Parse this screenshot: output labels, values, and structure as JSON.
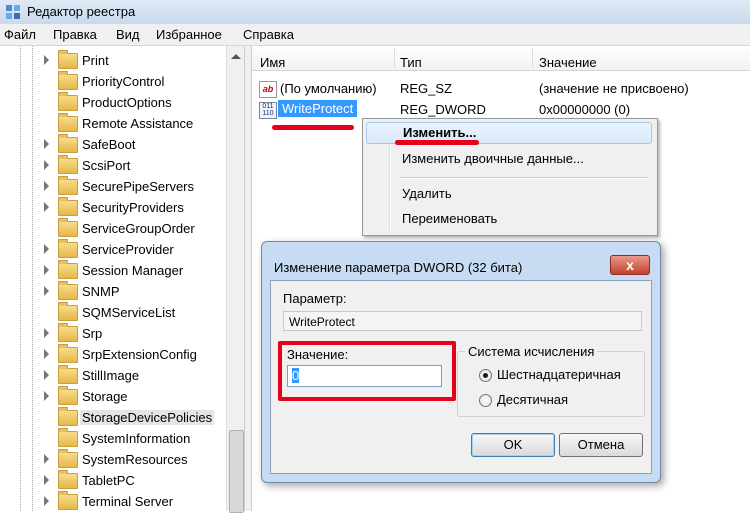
{
  "window": {
    "title": "Редактор реестра"
  },
  "menu": [
    "Файл",
    "Правка",
    "Вид",
    "Избранное",
    "Справка"
  ],
  "tree": {
    "items": [
      {
        "label": "Print",
        "expandable": true
      },
      {
        "label": "PriorityControl",
        "expandable": false
      },
      {
        "label": "ProductOptions",
        "expandable": false
      },
      {
        "label": "Remote Assistance",
        "expandable": false
      },
      {
        "label": "SafeBoot",
        "expandable": true
      },
      {
        "label": "ScsiPort",
        "expandable": true
      },
      {
        "label": "SecurePipeServers",
        "expandable": true
      },
      {
        "label": "SecurityProviders",
        "expandable": true
      },
      {
        "label": "ServiceGroupOrder",
        "expandable": false
      },
      {
        "label": "ServiceProvider",
        "expandable": true
      },
      {
        "label": "Session Manager",
        "expandable": true
      },
      {
        "label": "SNMP",
        "expandable": true
      },
      {
        "label": "SQMServiceList",
        "expandable": false
      },
      {
        "label": "Srp",
        "expandable": true
      },
      {
        "label": "SrpExtensionConfig",
        "expandable": true
      },
      {
        "label": "StillImage",
        "expandable": true
      },
      {
        "label": "Storage",
        "expandable": true
      },
      {
        "label": "StorageDevicePolicies",
        "expandable": false,
        "selected": true
      },
      {
        "label": "SystemInformation",
        "expandable": false
      },
      {
        "label": "SystemResources",
        "expandable": true
      },
      {
        "label": "TabletPC",
        "expandable": true
      },
      {
        "label": "Terminal Server",
        "expandable": true
      }
    ]
  },
  "list": {
    "headers": {
      "name": "Имя",
      "type": "Тип",
      "value": "Значение"
    },
    "rows": [
      {
        "name": "(По умолчанию)",
        "type": "REG_SZ",
        "value": "(значение не присвоено)",
        "icon": "string-value-icon"
      },
      {
        "name": "WriteProtect",
        "type": "REG_DWORD",
        "value": "0x00000000 (0)",
        "icon": "binary-value-icon"
      }
    ]
  },
  "context_menu": {
    "modify": "Изменить...",
    "modify_binary": "Изменить двоичные данные...",
    "delete": "Удалить",
    "rename": "Переименовать"
  },
  "dialog": {
    "title": "Изменение параметра DWORD (32 бита)",
    "close_label": "x",
    "param_label": "Параметр:",
    "param_value": "WriteProtect",
    "value_label": "Значение:",
    "value": "0",
    "base_label": "Система исчисления",
    "hex_label": "Шестнадцатеричная",
    "dec_label": "Десятичная",
    "hex_selected": true,
    "ok": "OK",
    "cancel": "Отмена"
  },
  "accent": {
    "highlight_red": "#e5001b",
    "selection_blue": "#3399ff"
  }
}
